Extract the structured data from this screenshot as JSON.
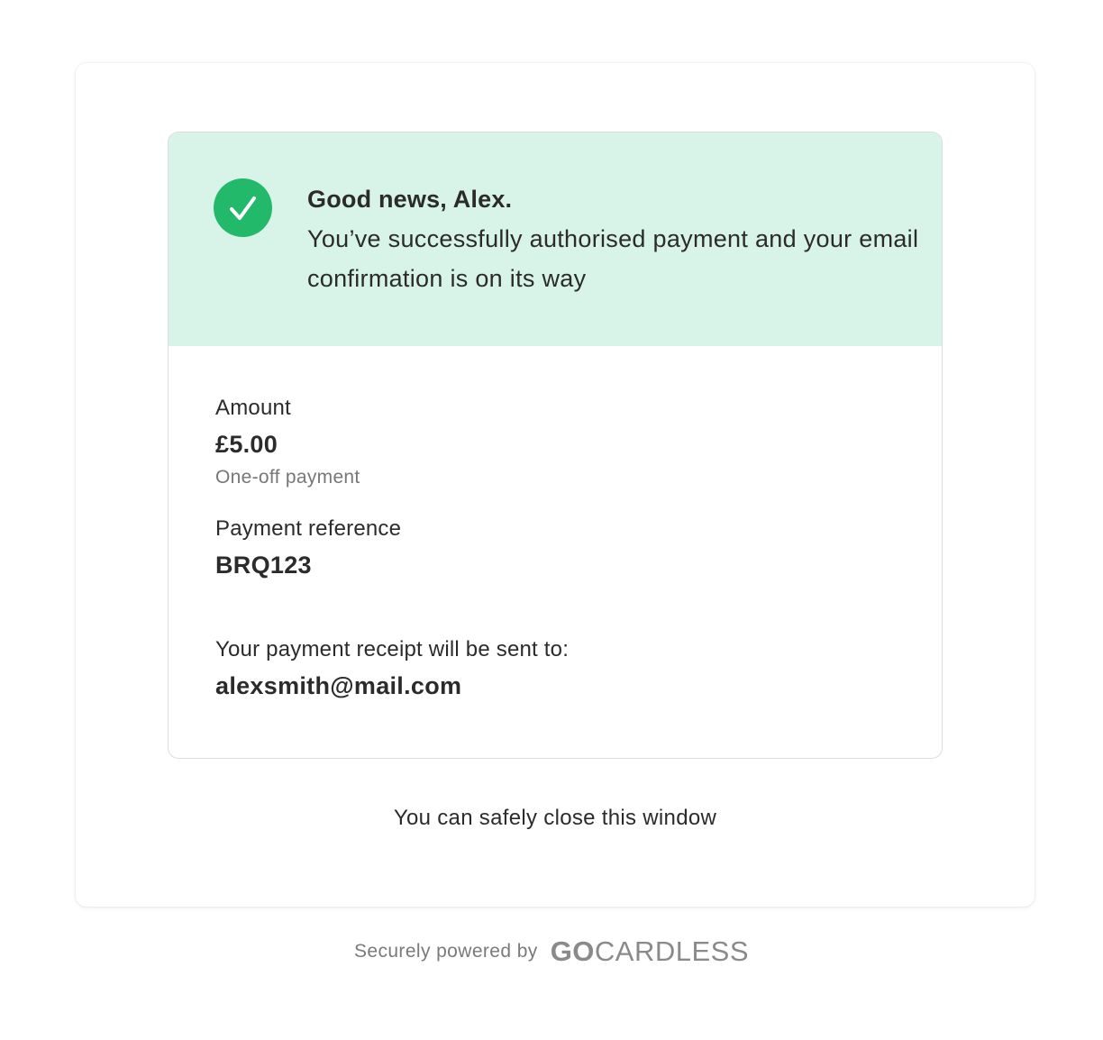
{
  "banner": {
    "heading": "Good news, Alex.",
    "message": "You’ve successfully authorised payment and your email confirmation is on its way",
    "icon": "check-circle-icon",
    "accent_color": "#23b96b",
    "background_color": "#d8f3e8"
  },
  "payment": {
    "amount_label": "Amount",
    "amount_value": "£5.00",
    "amount_type": "One-off payment",
    "reference_label": "Payment reference",
    "reference_value": "BRQ123",
    "receipt_label": "Your payment receipt will be sent to:",
    "receipt_email": "alexsmith@mail.com"
  },
  "close_note": "You can safely close this window",
  "footer": {
    "label": "Securely powered by",
    "logo_bold": "GO",
    "logo_regular": "CARDLESS"
  }
}
